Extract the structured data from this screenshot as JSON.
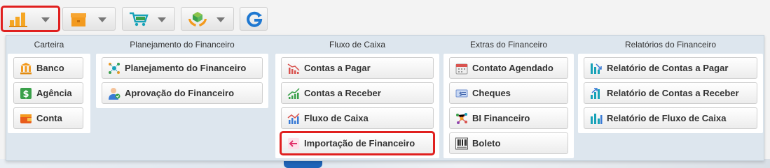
{
  "toolbar": {
    "buttons": [
      {
        "icon": "bar-chart-icon",
        "active": true
      },
      {
        "icon": "box-icon",
        "active": false
      },
      {
        "icon": "shopping-cart-icon",
        "active": false
      },
      {
        "icon": "hands-cube-icon",
        "active": false
      },
      {
        "icon": "refresh-g-icon",
        "active": false
      }
    ]
  },
  "menu": {
    "carteira": {
      "title": "Carteira",
      "items": [
        {
          "label": "Banco",
          "icon": "bank-icon"
        },
        {
          "label": "Agência",
          "icon": "dollar-icon"
        },
        {
          "label": "Conta",
          "icon": "wallet-icon"
        }
      ]
    },
    "planejamento": {
      "title": "Planejamento do Financeiro",
      "items": [
        {
          "label": "Planejamento do Financeiro",
          "icon": "network-icon"
        },
        {
          "label": "Aprovação do Financeiro",
          "icon": "user-approval-icon"
        }
      ]
    },
    "fluxo": {
      "title": "Fluxo de Caixa",
      "items": [
        {
          "label": "Contas a Pagar",
          "icon": "chart-down-icon"
        },
        {
          "label": "Contas a Receber",
          "icon": "chart-up-icon"
        },
        {
          "label": "Fluxo de Caixa",
          "icon": "chart-trend-icon"
        },
        {
          "label": "Importação de Financeiro",
          "icon": "import-arrow-icon",
          "highlighted": true
        }
      ]
    },
    "extras": {
      "title": "Extras do Financeiro",
      "items": [
        {
          "label": "Contato Agendado",
          "icon": "calendar-icon"
        },
        {
          "label": "Cheques",
          "icon": "cheque-icon"
        },
        {
          "label": "BI Financeiro",
          "icon": "bi-network-icon"
        },
        {
          "label": "Boleto",
          "icon": "barcode-icon"
        }
      ]
    },
    "relatorios": {
      "title": "Relatórios do Financeiro",
      "items": [
        {
          "label": "Relatório de Contas a Pagar",
          "icon": "report-down-icon"
        },
        {
          "label": "Relatório de Contas a Receber",
          "icon": "report-up-icon"
        },
        {
          "label": "Relatório de Fluxo de Caixa",
          "icon": "report-bars-icon"
        }
      ]
    }
  },
  "colors": {
    "accent_red": "#e0201f",
    "panel_bg": "#dde6ee",
    "icon_orange": "#f39a1e",
    "icon_teal": "#17a2b8",
    "icon_green": "#3aa04a"
  }
}
